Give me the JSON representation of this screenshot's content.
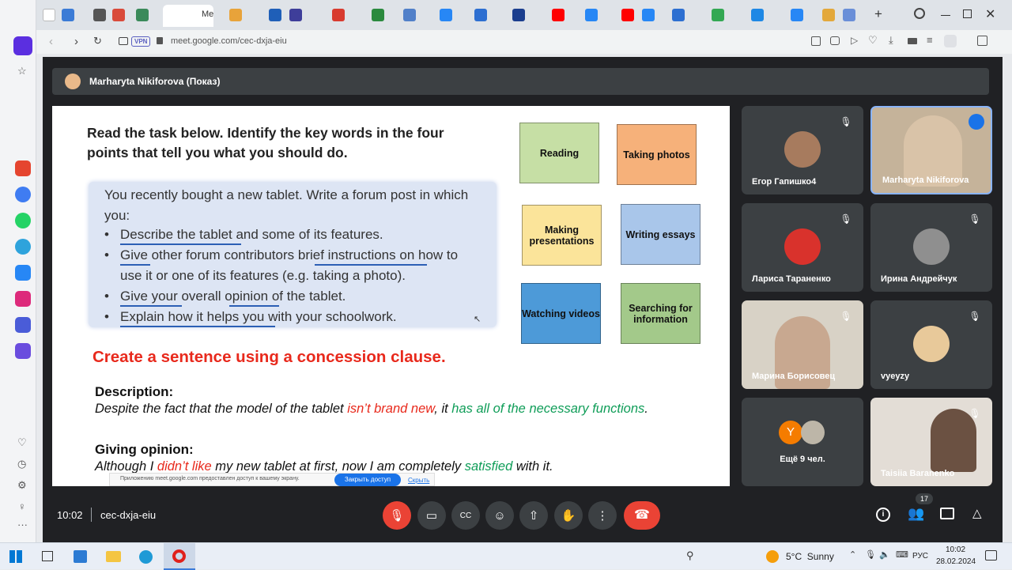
{
  "browser": {
    "tab_label": "Me",
    "url": "meet.google.com/cec-dxja-eiu",
    "vpn_label": "VPN"
  },
  "meet": {
    "presenter_bar": "Marharyta Nikiforova (Показ)",
    "time": "10:02",
    "meeting_code": "cec-dxja-eiu",
    "participants_count": "17"
  },
  "slide": {
    "heading": "Read the task below. Identify the key words in the four points that tell you what you should do.",
    "task_intro": "You recently bought a new tablet. Write a forum post in which you:",
    "bullets": [
      "Describe the tablet and some of its features.",
      "Give other forum contributors brief instructions on how to use it or one of its features (e.g. taking a photo).",
      "Give your overall opinion of the tablet.",
      "Explain how it helps you with your schoolwork."
    ],
    "notes": [
      "Reading",
      "Taking photos",
      "Making presentations",
      "Writing essays",
      "Watching videos",
      "Searching for information"
    ],
    "concession_title": "Create a sentence using a concession clause.",
    "desc_label": "Description:",
    "desc_part1": "Despite the fact that the model of the tablet ",
    "desc_red": "isn’t brand new",
    "desc_part2": ", it ",
    "desc_green": "has all of the necessary functions",
    "desc_end": ".",
    "opinion_label": "Giving opinion:",
    "op_part1": "Although I ",
    "op_red": "didn’t like",
    "op_part2": " my new tablet at first, now I am completely ",
    "op_green": "satisfied",
    "op_end": " with it.",
    "share_notice": "Приложению meet.google.com предоставлен доступ к вашему экрану.",
    "share_stop": "Закрыть доступ",
    "share_hide": "Скрыть"
  },
  "participants": [
    {
      "name": "Егор Гапишко4"
    },
    {
      "name": "Marharyta Nikiforova"
    },
    {
      "name": "Лариса Тараненко"
    },
    {
      "name": "Ирина Андрейчук"
    },
    {
      "name": "Марина Борисовец"
    },
    {
      "name": "vyeyzy"
    },
    {
      "name": "Ещё 9 чел.",
      "avatar_letter": "Y"
    },
    {
      "name": "Taisiia Baranenko"
    }
  ],
  "taskbar": {
    "weather": "5°C  Sunny",
    "lang": "РУС",
    "time": "10:02",
    "date": "28.02.2024"
  },
  "colors": {
    "accent_red": "#ea4335",
    "text_red": "#e8291c",
    "text_green": "#0f9d58",
    "note_green": "#c6dfa5",
    "note_orange": "#f6b17a",
    "note_yellow": "#fbe49a",
    "note_blue": "#a9c6ea",
    "note_blue_dark": "#4d9ad8",
    "note_green_dark": "#a3c98a"
  }
}
